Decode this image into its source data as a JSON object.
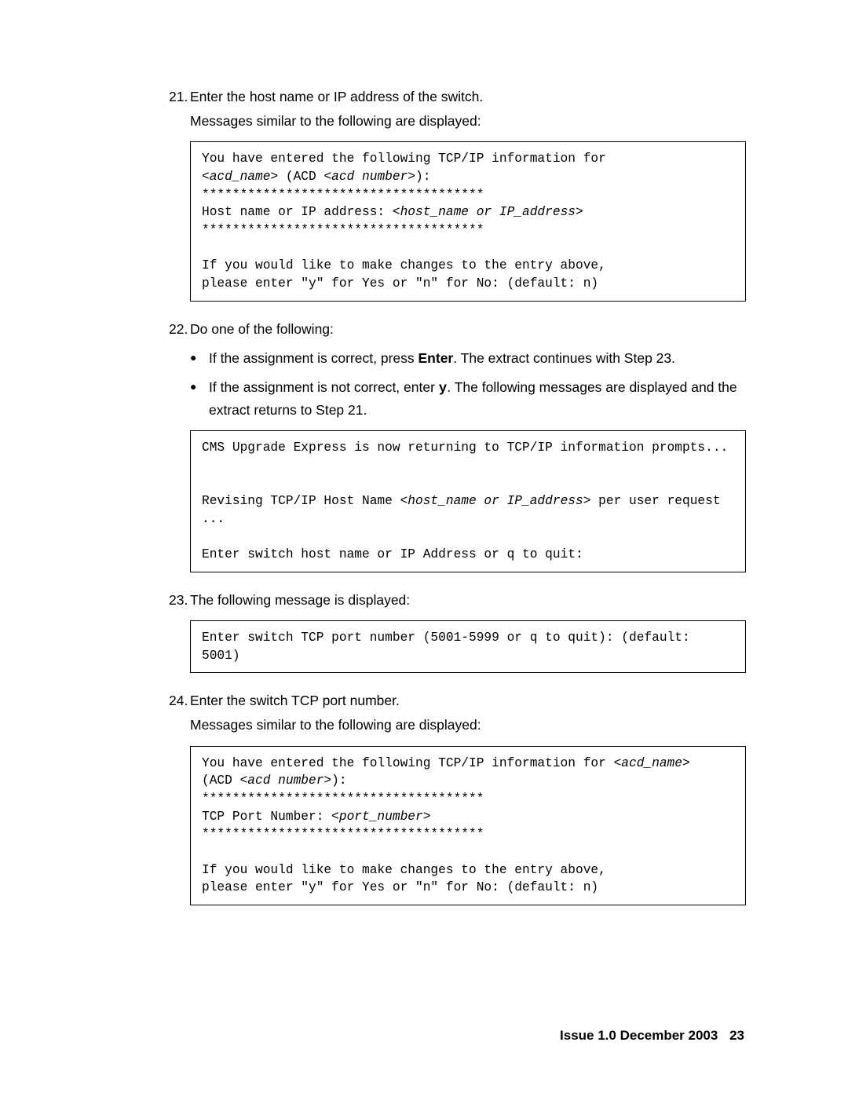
{
  "steps": {
    "s21": {
      "num": "21.",
      "text": "Enter the host name or IP address of the switch.",
      "subtext": "Messages similar to the following are displayed:",
      "code_prefix1": "You have entered the following TCP/IP information for",
      "code_italic1": "<acd_name>",
      "code_mid1": " (ACD ",
      "code_italic2": "<acd number>",
      "code_after2": "):",
      "code_stars": "*************************************",
      "code_hostline_pre": "Host name or IP address: ",
      "code_hostline_italic": "<host_name or IP_address>",
      "code_tail1": "If you would like to make changes to the entry above,",
      "code_tail2": "please enter \"y\" for Yes or \"n\" for No: (default: n)"
    },
    "s22": {
      "num": "22.",
      "text": "Do one of the following:",
      "bullet1_pre": "If the assignment is correct, press ",
      "bullet1_bold": "Enter",
      "bullet1_post": ". The extract continues with Step 23.",
      "bullet2_pre": "If the assignment is not correct, enter ",
      "bullet2_mono": "y",
      "bullet2_post": ". The following messages are displayed and the extract returns to Step 21.",
      "code_line1": "CMS Upgrade Express is now returning to TCP/IP information prompts...",
      "code_line2_pre": "Revising TCP/IP Host Name ",
      "code_line2_italic": "<host_name or IP_address>",
      "code_line2_post": " per user request ...",
      "code_line3": "Enter switch host name or IP Address or q to quit:"
    },
    "s23": {
      "num": "23.",
      "text": "The following message is displayed:",
      "code_line": "Enter switch TCP port number (5001-5999 or q to quit): (default: 5001)"
    },
    "s24": {
      "num": "24.",
      "text": "Enter the switch TCP port number.",
      "subtext": "Messages similar to the following are displayed:",
      "code_pre1": "You have entered the following TCP/IP information for ",
      "code_italic1": "<acd_name>",
      "code_line2_pre": "(ACD ",
      "code_line2_italic": "<acd number>",
      "code_line2_post": "):",
      "code_stars": "*************************************",
      "code_portline_pre": "TCP Port Number: ",
      "code_portline_italic": "<port_number>",
      "code_tail1": "If you would like to make changes to the entry above,",
      "code_tail2": "please enter \"y\" for Yes or \"n\" for No: (default: n)"
    }
  },
  "footer": {
    "issue": "Issue 1.0   December 2003",
    "page": "23"
  }
}
